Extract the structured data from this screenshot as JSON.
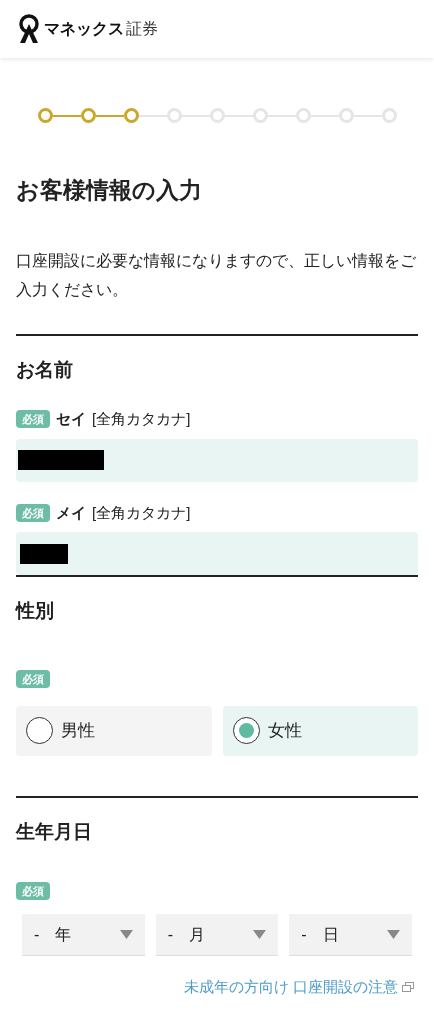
{
  "header": {
    "logo_text": "マネックス",
    "logo_suffix": "証券"
  },
  "steps": [
    {
      "done": true
    },
    {
      "done": true
    },
    {
      "done": true
    },
    {
      "done": false
    },
    {
      "done": false
    },
    {
      "done": false
    },
    {
      "done": false
    },
    {
      "done": false
    },
    {
      "done": false
    }
  ],
  "title": "お客様情報の入力",
  "intro": "口座開設に必要な情報になりますので、正しい情報をご入力ください。",
  "sections": [
    {
      "kind": "name",
      "heading": "お名前",
      "fields": [
        {
          "badge": "必須",
          "label": "セイ",
          "hint": "[全角カタカナ]",
          "redacted": true
        },
        {
          "badge": "必須",
          "label": "メイ",
          "hint": "[全角カタカナ]",
          "redacted": true
        }
      ]
    },
    {
      "kind": "radio",
      "heading": "性別",
      "badge": "必須",
      "options": [
        {
          "label": "男性",
          "selected": false
        },
        {
          "label": "女性",
          "selected": true
        }
      ]
    },
    {
      "kind": "date",
      "heading": "生年月日",
      "badge": "必須",
      "selects": [
        {
          "value": "-　年"
        },
        {
          "value": "-　月"
        },
        {
          "value": "-　日"
        }
      ],
      "link": "未成年の方向け 口座開設の注意"
    }
  ]
}
